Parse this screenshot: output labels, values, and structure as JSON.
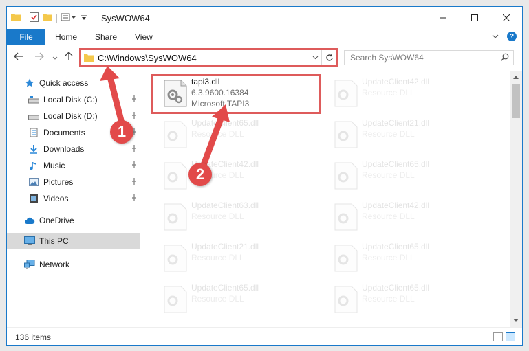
{
  "window": {
    "title": "SysWOW64"
  },
  "ribbon": {
    "file": "File",
    "tabs": [
      "Home",
      "Share",
      "View"
    ],
    "help": "?"
  },
  "navbar": {
    "address": "C:\\Windows\\SysWOW64",
    "search_placeholder": "Search SysWOW64"
  },
  "sidebar": {
    "items": [
      {
        "label": "Quick access",
        "icon": "star-icon",
        "pinned": false
      },
      {
        "label": "Local Disk (C:)",
        "icon": "drive-icon",
        "pinned": true
      },
      {
        "label": "Local Disk (D:)",
        "icon": "drive-icon",
        "pinned": true
      },
      {
        "label": "Documents",
        "icon": "documents-icon",
        "pinned": true
      },
      {
        "label": "Downloads",
        "icon": "download-icon",
        "pinned": true
      },
      {
        "label": "Music",
        "icon": "music-icon",
        "pinned": true
      },
      {
        "label": "Pictures",
        "icon": "pictures-icon",
        "pinned": true
      },
      {
        "label": "Videos",
        "icon": "videos-icon",
        "pinned": true
      },
      {
        "label": "OneDrive",
        "icon": "cloud-icon",
        "pinned": false
      },
      {
        "label": "This PC",
        "icon": "computer-icon",
        "pinned": false
      },
      {
        "label": "Network",
        "icon": "network-icon",
        "pinned": false
      }
    ]
  },
  "files": {
    "highlighted": {
      "name": "tapi3.dll",
      "version": "6.3.9600.16384",
      "description": "Microsoft TAPI3"
    },
    "faded": [
      {
        "name": "UpdateClient42.dll",
        "type": "Resource DLL"
      },
      {
        "name": "UpdateClient65.dll",
        "type": "Resource DLL"
      },
      {
        "name": "UpdateClient21.dll",
        "type": "Resource DLL"
      },
      {
        "name": "UpdateClient42.dll",
        "type": "Resource DLL"
      },
      {
        "name": "UpdateClient65.dll",
        "type": "Resource DLL"
      },
      {
        "name": "UpdateClient63.dll",
        "type": "Resource DLL"
      },
      {
        "name": "UpdateClient42.dll",
        "type": "Resource DLL"
      },
      {
        "name": "UpdateClient21.dll",
        "type": "Resource DLL"
      },
      {
        "name": "UpdateClient65.dll",
        "type": "Resource DLL"
      },
      {
        "name": "UpdateClient65.dll",
        "type": "Resource DLL"
      },
      {
        "name": "UpdateClient65.dll",
        "type": "Resource DLL"
      }
    ]
  },
  "status": {
    "items_count": "136 items"
  },
  "annotations": {
    "step1": "1",
    "step2": "2"
  },
  "colors": {
    "accent": "#1979ca",
    "annotation": "#e24a4a"
  }
}
